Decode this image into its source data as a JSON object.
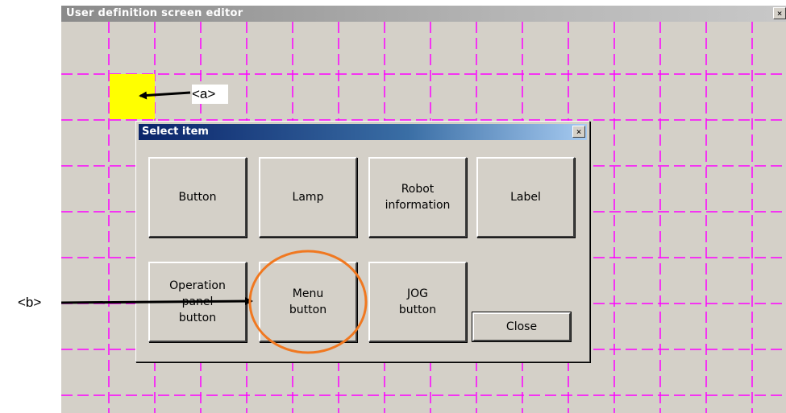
{
  "editor": {
    "title": "User definition screen editor",
    "close_glyph": "×",
    "grid_color": "#ff00ff",
    "highlight_color": "#ffff00"
  },
  "annotations": {
    "a": "<a>",
    "b": "<b>",
    "highlight_circle_color": "#f07820"
  },
  "dialog": {
    "title": "Select item",
    "close_glyph": "×",
    "buttons": [
      {
        "label": "Button"
      },
      {
        "label": "Lamp"
      },
      {
        "label": "Robot\ninformation"
      },
      {
        "label": "Label"
      },
      {
        "label": "Operation\npanel\nbutton"
      },
      {
        "label": "Menu\nbutton"
      },
      {
        "label": "JOG\nbutton"
      }
    ],
    "close_label": "Close"
  }
}
